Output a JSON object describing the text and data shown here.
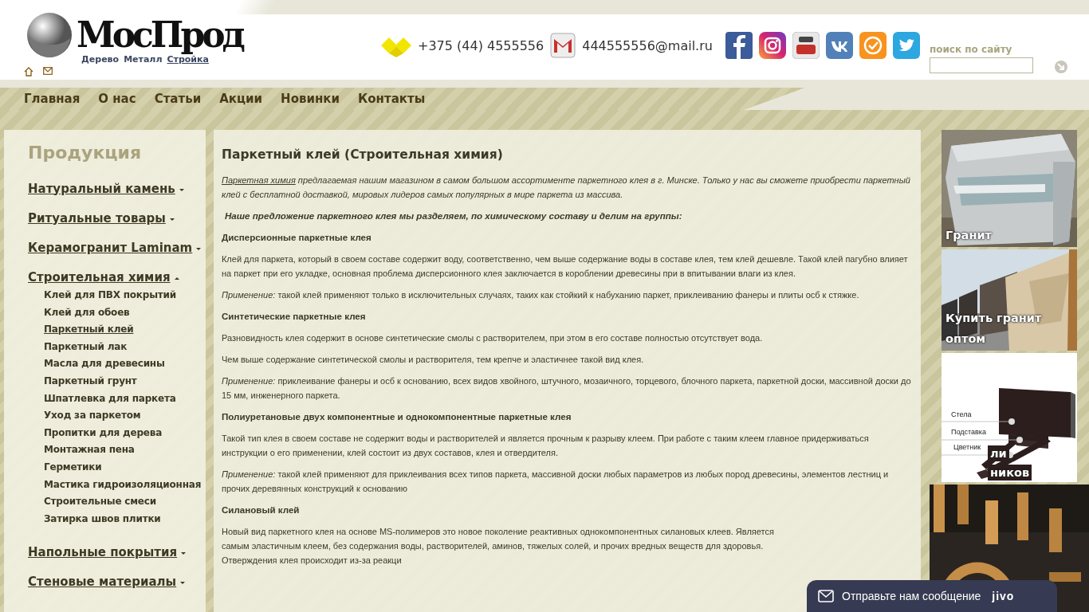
{
  "header": {
    "logo": {
      "text": "МосПрод",
      "links": [
        {
          "label": "Дерево",
          "selected": false
        },
        {
          "label": "Металл",
          "selected": false
        },
        {
          "label": "Стройка",
          "selected": true
        }
      ]
    },
    "phone": "+375 (44) 4555556",
    "email": "444555556@mail.ru",
    "search": {
      "label": "поиск по сайту"
    }
  },
  "nav": [
    "Главная",
    "О нас",
    "Статьи",
    "Акции",
    "Новинки",
    "Контакты"
  ],
  "sidebar": {
    "title": "Продукция",
    "categories": [
      {
        "label": "Натуральный камень",
        "expanded": false
      },
      {
        "label": "Ритуальные товары",
        "expanded": false
      },
      {
        "label": "Керамогранит Laminam",
        "expanded": false
      },
      {
        "label": "Строительная химия",
        "expanded": true,
        "children": [
          {
            "label": "Клей для ПВХ покрытий",
            "selected": false
          },
          {
            "label": "Клей для обоев",
            "selected": false
          },
          {
            "label": "Паркетный клей",
            "selected": true
          },
          {
            "label": "Паркетный лак",
            "selected": false
          },
          {
            "label": "Масла для древесины",
            "selected": false
          },
          {
            "label": "Паркетный грунт",
            "selected": false
          },
          {
            "label": "Шпатлевка для паркета",
            "selected": false
          },
          {
            "label": "Уход за паркетом",
            "selected": false
          },
          {
            "label": "Пропитки для дерева",
            "selected": false
          },
          {
            "label": "Монтажная пена",
            "selected": false
          },
          {
            "label": "Герметики",
            "selected": false
          },
          {
            "label": "Мастика гидроизоляционная",
            "selected": false
          },
          {
            "label": "Строительные смеси",
            "selected": false
          },
          {
            "label": "Затирка швов плитки",
            "selected": false
          }
        ]
      },
      {
        "label": "Напольные покрытия",
        "expanded": false
      },
      {
        "label": "Стеновые материалы",
        "expanded": false
      }
    ]
  },
  "article": {
    "title": "Паркетный клей (Строительная химия)",
    "blocks": [
      {
        "kind": "intro",
        "link": "Паркетная химия",
        "text": " предлагаемая нашим магазином в самом большом ассортименте паркетного клея в г. Минске. Только у нас вы сможете приобрести паркетный клей с бесплатной доставкой, мировых лидеров самых популярных в мире паркета из массива."
      },
      {
        "kind": "lead",
        "text": "Наше предложение паркетного клея мы разделяем, по химическому составу и делим на группы:"
      },
      {
        "kind": "heading",
        "text": "Дисперсионные паркетные клея"
      },
      {
        "kind": "paragraph",
        "text": "Клей для паркета, который в своем составе содержит воду, соответственно, чем выше содержание воды в составе клея, тем клей дешевле. Такой клей пагубно влияет на паркет при его укладке, основная проблема дисперсионного клея заключается в короблении древесины при в впитывании влаги из клея."
      },
      {
        "kind": "paragraph",
        "text": "*Применение:* такой клей применяют только в исключительных случаях, таких как стойкий к набуханию паркет, приклеиванию фанеры и плиты осб к стяжке."
      },
      {
        "kind": "heading",
        "text": "Синтетические паркетные клея"
      },
      {
        "kind": "paragraph",
        "text": "Разновидность клея содержит в основе синтетические смолы с растворителем, при этом в его составе полностью отсутствует вода."
      },
      {
        "kind": "paragraph",
        "text": "Чем выше содержание синтетической смолы и растворителя, тем крепче и эластичнее такой вид клея."
      },
      {
        "kind": "paragraph",
        "text": "*Применение:* приклеивание фанеры и осб к основанию, всех видов хвойного, штучного, мозаичного, торцевого, блочного паркета, паркетной доски, массивной доски до 15 мм, инженерного паркета."
      },
      {
        "kind": "heading",
        "text": "Полиуретановые двух компонентные и однокомпонентные паркетные клея"
      },
      {
        "kind": "paragraph",
        "text": "Такой тип клея в своем составе не содержит воды и растворителей и является прочным к разрыву клеем. При работе с таким клеем главное придерживаться инструкции о его применении, клей состоит из двух составов, клея и отвердителя."
      },
      {
        "kind": "paragraph",
        "text": "*Применение:* такой клей применяют для приклеивания всех типов паркета, массивной доски любых параметров из любых пород древесины, элементов лестниц и прочих деревянных конструкций к основанию"
      },
      {
        "kind": "heading",
        "text": "Силановый клей"
      },
      {
        "kind": "paragraph",
        "text": "Новый вид паркетного клея на основе MS-полимеров это новое поколение реактивных однокомпонентных силановых клеев.  Является самым эластичным клеем, без содержания воды, растворителей, аминов, тяжелых солей, и прочих вредных веществ для здоровья. Отверждения клея происходит из-за реакци"
      }
    ]
  },
  "banners": [
    {
      "kind": "block",
      "caption": [
        "Гранит"
      ]
    },
    {
      "kind": "slabs",
      "caption": [
        "Купить гранит",
        "оптом"
      ]
    },
    {
      "kind": "diagram",
      "labels": [
        "Стела",
        "Подставка",
        "Цветник"
      ],
      "caption": [
        "ли",
        "ников"
      ]
    },
    {
      "kind": "letters"
    }
  ],
  "chat": {
    "label": "Отправьте нам сообщение",
    "brand": "jivo"
  }
}
